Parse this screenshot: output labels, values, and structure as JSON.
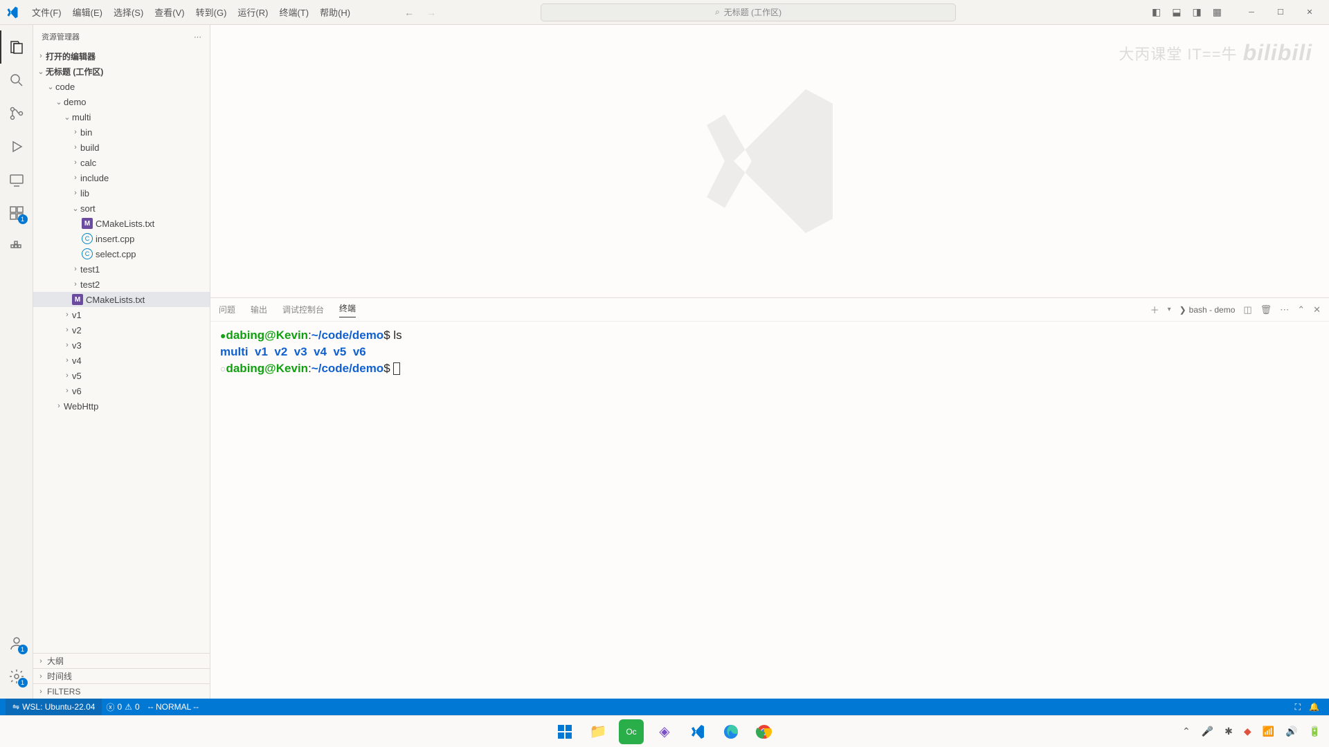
{
  "menu": {
    "file": "文件(F)",
    "edit": "编辑(E)",
    "select": "选择(S)",
    "view": "查看(V)",
    "go": "转到(G)",
    "run": "运行(R)",
    "terminal": "终端(T)",
    "help": "帮助(H)"
  },
  "search_placeholder": "无标题 (工作区)",
  "sidebar": {
    "title": "资源管理器",
    "open_editors": "打开的编辑器",
    "workspace": "无标题 (工作区)",
    "outline": "大纲",
    "timeline": "时间线",
    "filters": "FILTERS"
  },
  "tree": {
    "code": "code",
    "demo": "demo",
    "multi": "multi",
    "bin": "bin",
    "build": "build",
    "calc": "calc",
    "include": "include",
    "lib": "lib",
    "sort": "sort",
    "cmake1": "CMakeLists.txt",
    "insert": "insert.cpp",
    "selectf": "select.cpp",
    "test1": "test1",
    "test2": "test2",
    "cmake2": "CMakeLists.txt",
    "v1": "v1",
    "v2": "v2",
    "v3": "v3",
    "v4": "v4",
    "v5": "v5",
    "v6": "v6",
    "webhttp": "WebHttp"
  },
  "panel": {
    "tabs": {
      "problems": "问题",
      "output": "输出",
      "debug": "调试控制台",
      "terminal": "终端"
    },
    "shell": "bash - demo"
  },
  "terminal": {
    "prompt_user": "dabing@Kevin",
    "prompt_path": "~/code/demo",
    "cmd": "ls",
    "ls_out": "multi  v1  v2  v3  v4  v5  v6"
  },
  "status": {
    "remote": "WSL: Ubuntu-22.04",
    "errors": "0",
    "warnings": "0",
    "vim": "-- NORMAL --"
  },
  "badges": {
    "ext": "1",
    "acct": "1",
    "gear": "1"
  },
  "watermark": {
    "text": "大丙课堂 IT==牛",
    "logo": "bilibili"
  }
}
